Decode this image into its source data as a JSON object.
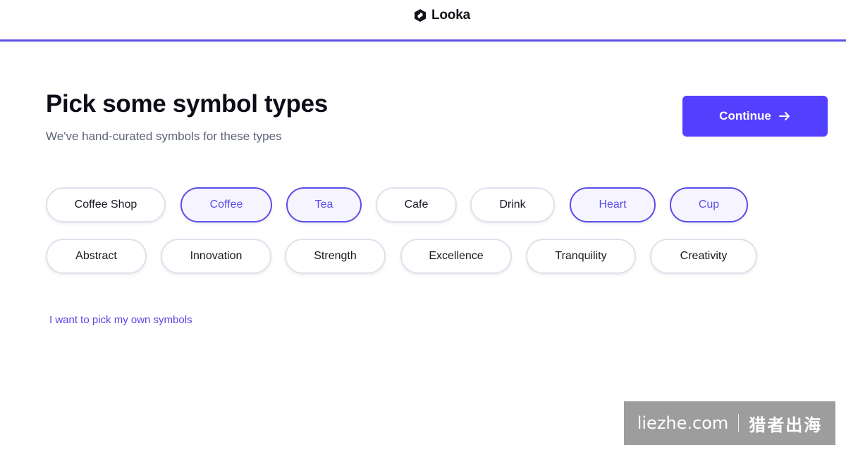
{
  "header": {
    "brand_name": "Looka",
    "logo_icon": "looka-logo-icon",
    "accent_color": "#5b4ee8"
  },
  "main": {
    "title": "Pick some symbol types",
    "subtitle": "We've hand-curated symbols for these types",
    "continue_label": "Continue",
    "continue_icon": "arrow-right-icon",
    "button_color": "#5340ff",
    "tags": [
      {
        "label": "Coffee Shop",
        "selected": false
      },
      {
        "label": "Coffee",
        "selected": true
      },
      {
        "label": "Tea",
        "selected": true
      },
      {
        "label": "Cafe",
        "selected": false
      },
      {
        "label": "Drink",
        "selected": false
      },
      {
        "label": "Heart",
        "selected": true
      },
      {
        "label": "Cup",
        "selected": true
      },
      {
        "label": "Abstract",
        "selected": false
      },
      {
        "label": "Innovation",
        "selected": false
      },
      {
        "label": "Strength",
        "selected": false
      },
      {
        "label": "Excellence",
        "selected": false
      },
      {
        "label": "Tranquility",
        "selected": false
      },
      {
        "label": "Creativity",
        "selected": false
      }
    ],
    "own_symbols_link": "I want to pick my own symbols"
  },
  "watermark": {
    "domain": "liezhe.com",
    "cn_text": "猎者出海"
  }
}
